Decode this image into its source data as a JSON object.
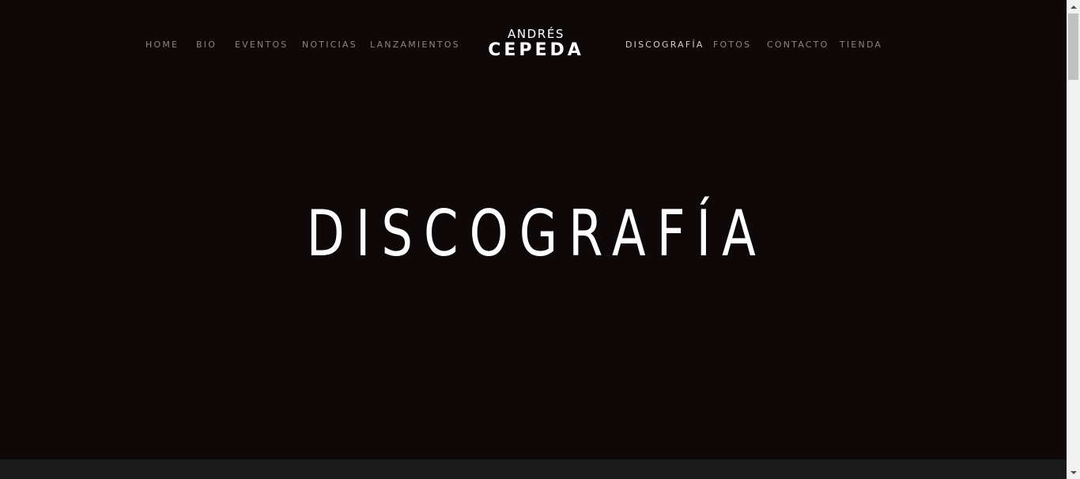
{
  "nav": {
    "items": [
      {
        "label": "HOME"
      },
      {
        "label": "BIO"
      },
      {
        "label": "EVENTOS"
      },
      {
        "label": "NOTICIAS"
      },
      {
        "label": "LANZAMIENTOS"
      },
      {
        "label": "DISCOGRAFÍA",
        "active": true
      },
      {
        "label": "FOTOS"
      },
      {
        "label": "CONTACTO"
      },
      {
        "label": "TIENDA"
      }
    ]
  },
  "logo": {
    "top_text": "ANDRÉS",
    "bottom_text": "CEPEDA"
  },
  "hero": {
    "title": "DISCOGRAFÍA"
  },
  "colors": {
    "background": "#0f0808",
    "nav_text": "#8a8583",
    "nav_active": "#d4d0ce",
    "title": "#ffffff",
    "bottom_band": "#1a1a1a"
  }
}
